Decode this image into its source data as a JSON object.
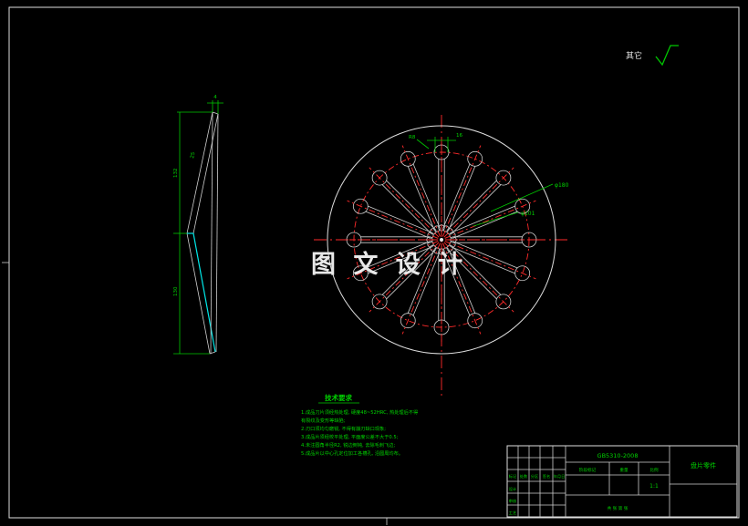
{
  "corner": {
    "other_surfaces_label": "其它"
  },
  "watermark": {
    "text": "图 文 设 计"
  },
  "side_view": {
    "dim_thickness": "4",
    "dim_angle": "25",
    "dim_upper": "132",
    "dim_lower": "130"
  },
  "front_view": {
    "dim_radius": "R8",
    "dim_width": "16",
    "leader_upper": "φ180",
    "leader_lower": "φ101"
  },
  "notes": {
    "title": "技术要求",
    "lines": [
      "1.成品刀片须经热处理, 硬度48~52HRC, 热处理后不得",
      "  有裂纹及变形等缺陷;",
      "2.刃口须均匀磨锐, 不得有崩刃缺口现象;",
      "3.成品片须经校平处理, 平面度公差不大于0.5;",
      "4.未注圆角半径R2, 锐边倒钝, 去除毛刺飞边;",
      "5.成品片以中心孔定位加工各槽孔, 沿圆周均布。"
    ]
  },
  "title_block": {
    "code": "GB5310-2008",
    "part_name": "盘片零件",
    "headers": [
      "标记",
      "处数",
      "分区",
      "签名",
      "年月日"
    ],
    "roles": [
      "设计",
      "审核",
      "工艺"
    ],
    "stage_label": "阶段标记",
    "weight_label": "重量",
    "scale_label": "比例",
    "scale_value": "1:1",
    "sheet_label": "共 张 第 张"
  }
}
